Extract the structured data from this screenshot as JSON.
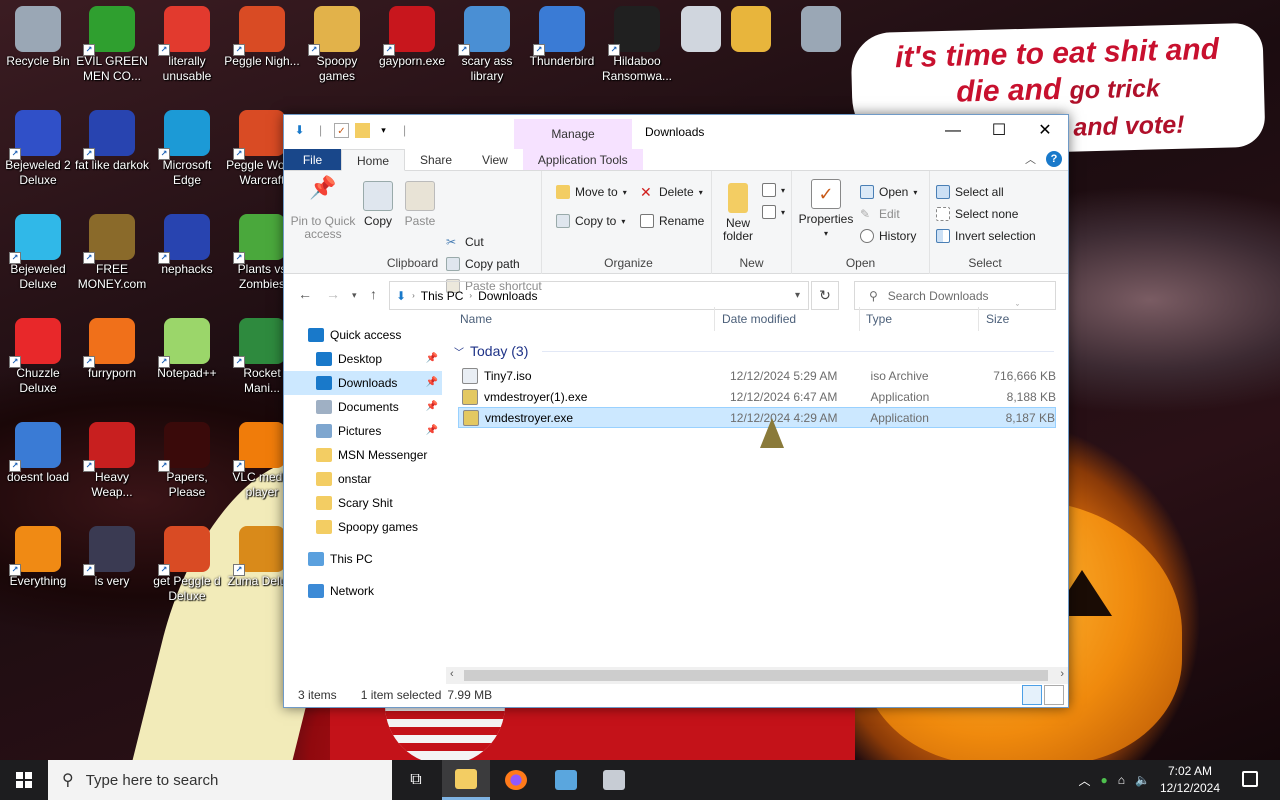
{
  "desktop": {
    "icons": [
      {
        "label": "Recycle Bin",
        "icon": "recycle-bin-icon",
        "color": "#9aa7b5"
      },
      {
        "label": "EVIL GREEN MEN CO...",
        "icon": "msn-people-icon",
        "color": "#2f9f2f"
      },
      {
        "label": "literally unusable",
        "icon": "chrome-icon",
        "color": "#e23a2e"
      },
      {
        "label": "Peggle Nigh...",
        "icon": "peggle-icon",
        "color": "#d94b24"
      },
      {
        "label": "Spoopy games",
        "icon": "folder-icon",
        "color": "#e2b24a"
      },
      {
        "label": "gayporn.exe",
        "icon": "flash-icon",
        "color": "#c8161d"
      },
      {
        "label": "scary ass library",
        "icon": "network-computers-icon",
        "color": "#4a8fd4"
      },
      {
        "label": "Thunderbird",
        "icon": "thunderbird-icon",
        "color": "#3a7bd5"
      },
      {
        "label": "Hildaboo Ransomwa...",
        "icon": "yashma-shield-icon",
        "color": "#202020"
      },
      {
        "label": "Bejeweled 2 Deluxe",
        "icon": "bejeweled-2-icon",
        "color": "#3050c8"
      },
      {
        "label": "fat like darkok",
        "icon": "mpi-icon",
        "color": "#2844b0"
      },
      {
        "label": "Microsoft Edge",
        "icon": "edge-icon",
        "color": "#1c9ad6"
      },
      {
        "label": "Peggle Wo of Warcraft",
        "icon": "peggle-icon",
        "color": "#d94b24"
      },
      {
        "label": "Bejeweled Deluxe",
        "icon": "diamond-icon",
        "color": "#30b8e8"
      },
      {
        "label": "FREE MONEY.com",
        "icon": "money-bag-icon",
        "color": "#8a6a2a"
      },
      {
        "label": "nephacks",
        "icon": "mpi-icon",
        "color": "#2844b0"
      },
      {
        "label": "Plants vs Zombies",
        "icon": "plants-icon",
        "color": "#4aa83c"
      },
      {
        "label": "Chuzzle Deluxe",
        "icon": "chuzzle-icon",
        "color": "#e8282a"
      },
      {
        "label": "furryporn",
        "icon": "firefox-icon",
        "color": "#f0701a"
      },
      {
        "label": "Notepad++",
        "icon": "notepad-plus-icon",
        "color": "#9bd66a"
      },
      {
        "label": "Rocket Mani...",
        "icon": "rocket-icon",
        "color": "#2e8a3e"
      },
      {
        "label": "doesnt load",
        "icon": "thunderbird-icon",
        "color": "#3a7bd5"
      },
      {
        "label": "Heavy Weap...",
        "icon": "radiation-icon",
        "color": "#c81f1f"
      },
      {
        "label": "Papers, Please",
        "icon": "papers-please-icon",
        "color": "#3a0a0a"
      },
      {
        "label": "VLC media player",
        "icon": "vlc-icon",
        "color": "#f07c0a"
      },
      {
        "label": "Everything",
        "icon": "search-ring-icon",
        "color": "#f08a14"
      },
      {
        "label": "is very",
        "icon": "mpi-shield-icon",
        "color": "#3a3a52"
      },
      {
        "label": "get Peggle d Deluxe",
        "icon": "peggle-icon",
        "color": "#d94b24"
      },
      {
        "label": "Zuma Delu...",
        "icon": "zuma-icon",
        "color": "#d98a1a"
      }
    ],
    "top_extra_icons": [
      {
        "icon": "drive-icon",
        "color": "#d0d6de"
      },
      {
        "icon": "folder-icon",
        "color": "#e8b53c"
      },
      {
        "icon": "recycle-bin-icon",
        "color": "#9aa7b5"
      }
    ],
    "meme_text_red": "it's time to eat shit and die and",
    "meme_text_small": "go trick",
    "meme_text_last": "and vote!"
  },
  "window": {
    "title": "Downloads",
    "manage_label": "Manage",
    "tabs": {
      "file": "File",
      "home": "Home",
      "share": "Share",
      "view": "View",
      "app_tools": "Application Tools"
    },
    "ribbon": {
      "clipboard": {
        "label": "Clipboard",
        "pin": "Pin to Quick access",
        "copy": "Copy",
        "paste": "Paste",
        "cut": "Cut",
        "copy_path": "Copy path",
        "paste_shortcut": "Paste shortcut"
      },
      "organize": {
        "label": "Organize",
        "move_to": "Move to",
        "copy_to": "Copy to",
        "delete": "Delete",
        "rename": "Rename"
      },
      "new": {
        "label": "New",
        "new_folder": "New folder"
      },
      "open": {
        "label": "Open",
        "properties": "Properties",
        "open": "Open",
        "edit": "Edit",
        "history": "History"
      },
      "select": {
        "label": "Select",
        "select_all": "Select all",
        "select_none": "Select none",
        "invert": "Invert selection"
      }
    },
    "address": {
      "crumbs": [
        "This PC",
        "Downloads"
      ]
    },
    "search_placeholder": "Search Downloads",
    "nav": [
      {
        "label": "Quick access",
        "icon": "star-icon",
        "color": "#1979ca",
        "level": 0,
        "pinned": false,
        "selected": false
      },
      {
        "label": "Desktop",
        "icon": "desktop-icon",
        "color": "#1979ca",
        "level": 1,
        "pinned": true,
        "selected": false
      },
      {
        "label": "Downloads",
        "icon": "download-arrow-icon",
        "color": "#1979ca",
        "level": 1,
        "pinned": true,
        "selected": true
      },
      {
        "label": "Documents",
        "icon": "documents-icon",
        "color": "#9fb0c4",
        "level": 1,
        "pinned": true,
        "selected": false
      },
      {
        "label": "Pictures",
        "icon": "pictures-icon",
        "color": "#7ea6cf",
        "level": 1,
        "pinned": true,
        "selected": false
      },
      {
        "label": "MSN Messenger",
        "icon": "folder-icon",
        "color": "#f3cd63",
        "level": 1,
        "pinned": false,
        "selected": false
      },
      {
        "label": "onstar",
        "icon": "folder-icon",
        "color": "#f3cd63",
        "level": 1,
        "pinned": false,
        "selected": false
      },
      {
        "label": "Scary Shit",
        "icon": "folder-icon",
        "color": "#f3cd63",
        "level": 1,
        "pinned": false,
        "selected": false
      },
      {
        "label": "Spoopy games",
        "icon": "folder-icon",
        "color": "#f3cd63",
        "level": 1,
        "pinned": false,
        "selected": false
      },
      {
        "label": "This PC",
        "icon": "this-pc-icon",
        "color": "#5aa0de",
        "level": 0,
        "pinned": false,
        "selected": false
      },
      {
        "label": "Network",
        "icon": "network-icon",
        "color": "#3c8ad6",
        "level": 0,
        "pinned": false,
        "selected": false
      }
    ],
    "columns": {
      "name": "Name",
      "date": "Date modified",
      "type": "Type",
      "size": "Size"
    },
    "group_header": "Today (3)",
    "files": [
      {
        "name": "Tiny7.iso",
        "date": "12/12/2024 5:29 AM",
        "type": "iso Archive",
        "size": "716,666 KB",
        "icon": "iso-file-icon",
        "selected": false
      },
      {
        "name": "vmdestroyer(1).exe",
        "date": "12/12/2024 6:47 AM",
        "type": "Application",
        "size": "8,188 KB",
        "icon": "exe-installer-icon",
        "selected": false
      },
      {
        "name": "vmdestroyer.exe",
        "date": "12/12/2024 4:29 AM",
        "type": "Application",
        "size": "8,187 KB",
        "icon": "exe-installer-icon",
        "selected": true
      }
    ],
    "status": {
      "items": "3 items",
      "selected": "1 item selected",
      "size": "7.99 MB"
    }
  },
  "taskbar": {
    "search_placeholder": "Type here to search",
    "time": "7:02 AM",
    "date": "12/12/2024"
  }
}
